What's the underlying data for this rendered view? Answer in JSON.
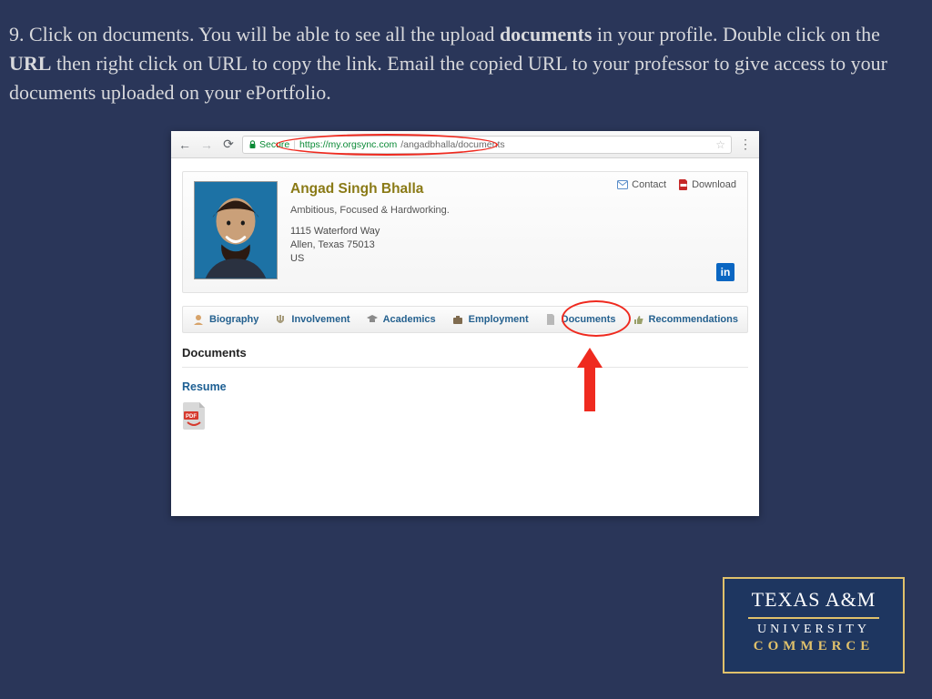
{
  "instruction": {
    "prefix": "9. Click on documents. You will be able to see all the upload ",
    "bold1": "documents",
    "mid1": " in your profile. Double click on the ",
    "bold2": "URL",
    "mid2": " then right click on URL to copy the link. Email the copied URL to your professor to give access to your documents uploaded on your ePortfolio."
  },
  "browser": {
    "secure_label": "Secure",
    "url_secure": "https://my.orgsync.com",
    "url_rest": "/angadbhalla/documents"
  },
  "profile": {
    "name": "Angad Singh Bhalla",
    "tagline": "Ambitious, Focused & Hardworking.",
    "addr1": "1115 Waterford Way",
    "addr2": "Allen, Texas 75013",
    "addr3": "US",
    "contact": "Contact",
    "download": "Download",
    "linkedin": "in"
  },
  "tabs": {
    "t0": "Biography",
    "t1": "Involvement",
    "t2": "Academics",
    "t3": "Employment",
    "t4": "Documents",
    "t5": "Recommendations"
  },
  "section": {
    "title": "Documents",
    "resume": "Resume"
  },
  "logo": {
    "line1": "TEXAS A&M",
    "line2": "UNIVERSITY",
    "line3": "COMMERCE"
  }
}
